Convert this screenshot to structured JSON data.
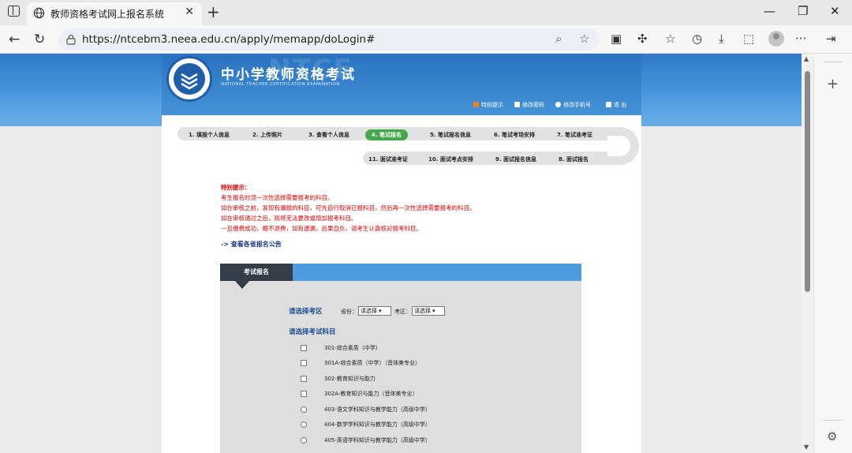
{
  "browser": {
    "tab_title": "教师资格考试网上报名系统",
    "tab_close": "✕",
    "new_tab": "+",
    "url": "https://ntcebm3.neea.edu.cn/apply/memapp/doLogin#",
    "win_min": "—",
    "win_max": "❐",
    "win_close": "✕",
    "back": "←",
    "refresh": "↻",
    "more": "···"
  },
  "header": {
    "watermark": "NTCE",
    "title": "中小学教师资格考试",
    "subtitle": "NATIONAL TEACHER CERTIFICATION EXAMINATION",
    "links": [
      {
        "label": "特别提示",
        "color": "#f08020"
      },
      {
        "label": "修改密码",
        "color": "#ffffff"
      },
      {
        "label": "修改手机号",
        "color": "#ffffff"
      },
      {
        "label": "退 出",
        "color": "#ffffff"
      }
    ]
  },
  "steps_row1": [
    "1. 填报个人信息",
    "2. 上传照片",
    "3. 查看个人信息",
    "4. 笔试报名",
    "5. 笔试报名信息",
    "6. 笔试考场安排",
    "7. 笔试准考证"
  ],
  "steps_row2": [
    "11. 面试准考证",
    "10. 面试考点安排",
    "9. 面试报名信息",
    "8. 面试报名"
  ],
  "notice": {
    "title": "特别提示：",
    "lines": [
      "考生报名时须一次性选择需要报考的科目。",
      "如在审核之前，发现有漏报的科目，可先自行取消已报科目，然后再一次性选择需要报考的科目。",
      "如在审核通过之后，则将无法更改或增加报考科目。",
      "一旦缴费成功，概不退费，如有遗漏，后果自负，请考生认真核对报考科目。"
    ]
  },
  "announce_link": "-> 查看各省报名公告",
  "panel": {
    "tab": "考试报名",
    "area_label": "请选择考区",
    "province_label": "省份：",
    "province_value": "请选择",
    "district_label": "考区：",
    "district_value": "请选择",
    "subject_label": "请选择考试科目",
    "subjects": [
      {
        "label": "301-综合素质（中学）",
        "kind": "checkbox"
      },
      {
        "label": "301A-综合素质（中学）（音体美专业）",
        "kind": "checkbox"
      },
      {
        "label": "302-教育知识与能力",
        "kind": "checkbox"
      },
      {
        "label": "302A-教育知识与能力（音体美专业）",
        "kind": "checkbox"
      },
      {
        "label": "403-语文学科知识与教学能力（高级中学）",
        "kind": "radio"
      },
      {
        "label": "404-数学学科知识与教学能力（高级中学）",
        "kind": "radio"
      },
      {
        "label": "405-英语学科知识与教学能力（高级中学）",
        "kind": "radio"
      }
    ]
  }
}
